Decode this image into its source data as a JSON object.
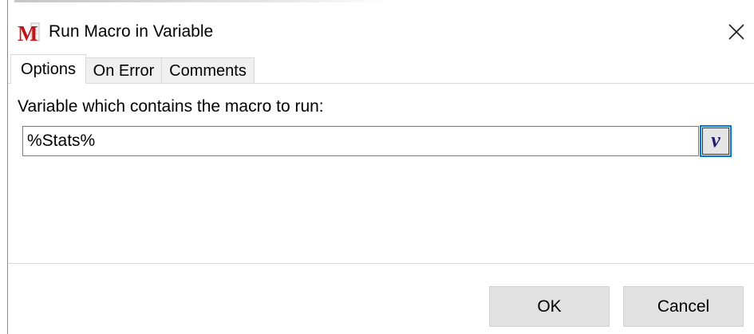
{
  "window": {
    "title": "Run Macro in Variable",
    "app_icon": "macro-app-icon",
    "close_icon": "close-icon"
  },
  "tabs": [
    {
      "label": "Options",
      "active": true
    },
    {
      "label": "On Error",
      "active": false
    },
    {
      "label": "Comments",
      "active": false
    }
  ],
  "options": {
    "variable_label": "Variable which contains the macro to run:",
    "variable_value": "%Stats%",
    "variable_button_label": "v"
  },
  "footer": {
    "ok_label": "OK",
    "cancel_label": "Cancel"
  },
  "colors": {
    "accent": "#0078d7",
    "app_icon_red": "#c0161b",
    "button_face": "#e1e1e1"
  }
}
